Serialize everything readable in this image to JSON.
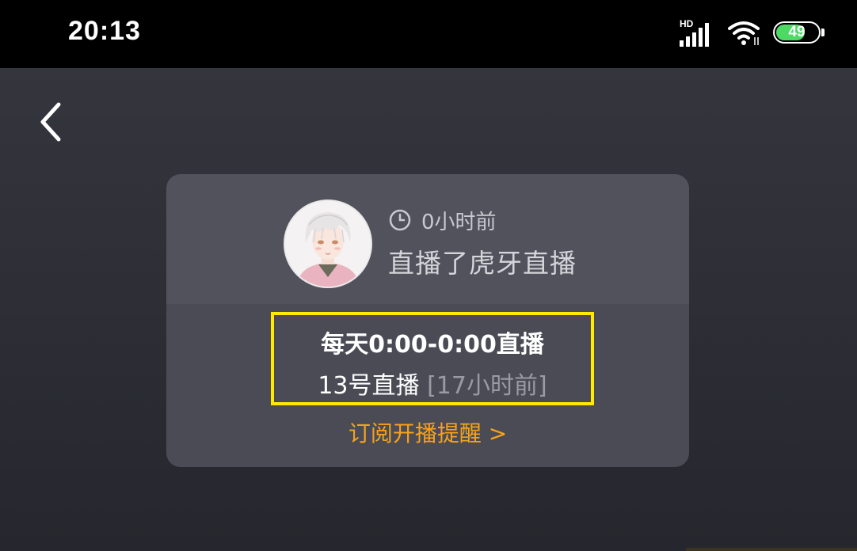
{
  "status_bar": {
    "time": "20:13",
    "network_label": "HD",
    "battery_level": "49",
    "battery_color": "#4cd964",
    "signal_icon": "signal-icon",
    "wifi_icon": "wifi-icon"
  },
  "nav": {
    "back_icon": "chevron-left-icon"
  },
  "card": {
    "time_ago": "0小时前",
    "streamed_text": "直播了虎牙直播",
    "schedule": "每天0:00-0:00直播",
    "last_live": "13号直播",
    "last_live_ago": "[17小时前]",
    "subscribe_link": "订阅开播提醒 >",
    "accent_color": "#f7a21c",
    "highlight_color": "#ffea00"
  }
}
